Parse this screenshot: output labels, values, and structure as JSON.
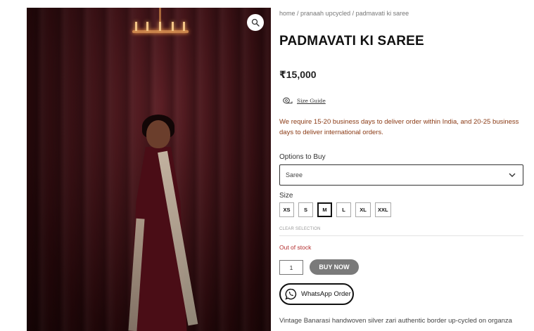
{
  "breadcrumb": {
    "home": "home",
    "sep": " / ",
    "category": "pranaah upcycled",
    "current": "padmavati ki saree"
  },
  "product": {
    "title": "PADMAVATI KI SAREE",
    "price": "₹15,000"
  },
  "size_guide": {
    "label": "Size Guide",
    "icon": "tape-measure-icon"
  },
  "notice": "We require 15-20 business days to deliver order within India, and 20-25 business days to deliver international orders.",
  "options": {
    "label": "Options to Buy",
    "selected": "Saree"
  },
  "size": {
    "label": "Size",
    "items": [
      "XS",
      "S",
      "M",
      "L",
      "XL",
      "XXL"
    ],
    "selected": "M",
    "clear_label": "CLEAR SELECTION"
  },
  "stock_status": "Out of stock",
  "quantity": "1",
  "buy_label": "BUY NOW",
  "whatsapp_label": "WhatsApp Order",
  "description": "Vintage Banarasi handwoven silver zari authentic border up-cycled on organza",
  "colors": {
    "notice": "#8a3a14",
    "stock": "#b32d2e",
    "buy_button": "#7a7a7a"
  }
}
